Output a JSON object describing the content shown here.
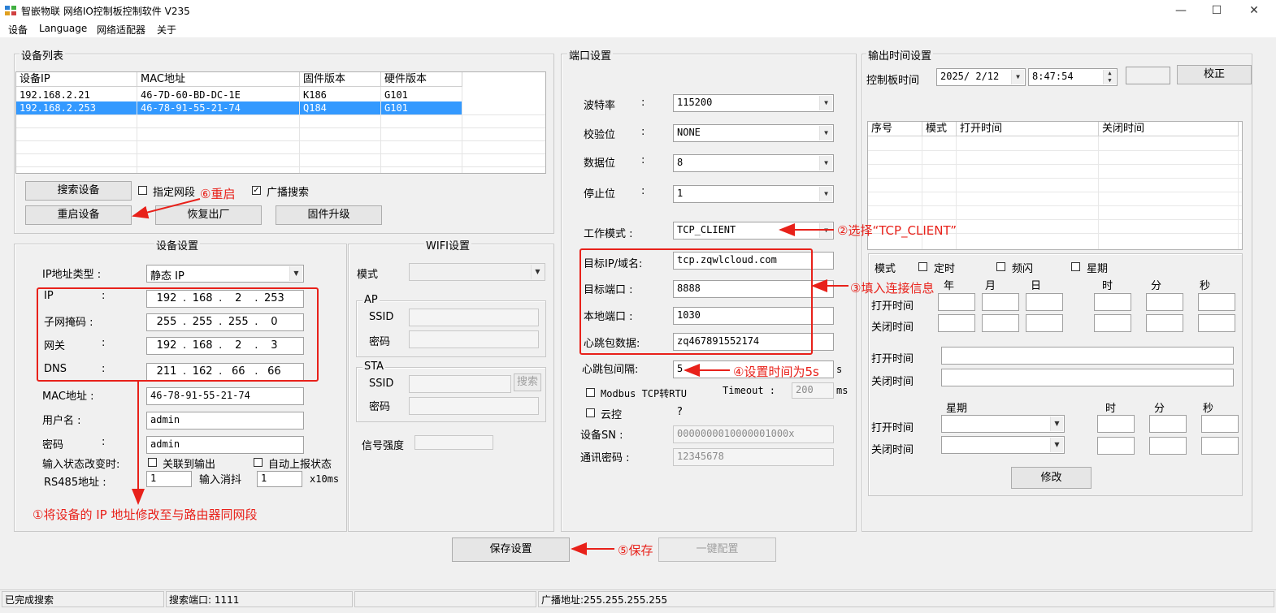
{
  "window": {
    "title": "智嵌物联 网络IO控制板控制软件   V235",
    "min": "—",
    "max": "☐",
    "close": "✕"
  },
  "menu": [
    "设备",
    "Language",
    "网络适配器",
    "关于"
  ],
  "device_list": {
    "legend": "设备列表",
    "columns": [
      "设备IP",
      "MAC地址",
      "固件版本",
      "硬件版本"
    ],
    "rows": [
      {
        "ip": "192.168.2.21",
        "mac": "46-7D-60-BD-DC-1E",
        "fw": "K186",
        "hw": "G101"
      },
      {
        "ip": "192.168.2.253",
        "mac": "46-78-91-55-21-74",
        "fw": "Q184",
        "hw": "G101"
      }
    ],
    "search_btn": "搜索设备",
    "specify_segment": "指定网段",
    "broadcast_search": "广播搜索",
    "restart_btn": "重启设备",
    "factory_btn": "恢复出厂",
    "upgrade_btn": "固件升级"
  },
  "device_settings": {
    "legend": "设备设置",
    "ip_type_label": "IP地址类型 :",
    "ip_type_value": "静态 IP",
    "ip_label": "IP",
    "ip": [
      "192",
      "168",
      "2",
      "253"
    ],
    "mask_label": "子网掩码 :",
    "mask": [
      "255",
      "255",
      "255",
      "0"
    ],
    "gateway_label": "网关",
    "gateway": [
      "192",
      "168",
      "2",
      "3"
    ],
    "dns_label": "DNS",
    "dns": [
      "211",
      "162",
      "66",
      "66"
    ],
    "colon": ":",
    "dot": ".",
    "mac_label": "MAC地址 :",
    "mac": "46-78-91-55-21-74",
    "user_label": "用户名 :",
    "user": "admin",
    "pwd_label": "密码",
    "pwd": "admin",
    "input_change_label": "输入状态改变时:",
    "link_output": "关联到输出",
    "auto_report": "自动上报状态",
    "rs485_label": "RS485地址 :",
    "rs485": "1",
    "debounce_label": "输入消抖",
    "debounce": "1",
    "debounce_unit": "x10ms"
  },
  "wifi": {
    "legend": "WIFI设置",
    "mode_label": "模式",
    "ap": "AP",
    "sta": "STA",
    "ssid_label": "SSID",
    "pwd_label": "密码",
    "search_btn": "搜索",
    "signal_label": "信号强度"
  },
  "port": {
    "legend": "端口设置",
    "baud_label": "波特率",
    "baud": "115200",
    "parity_label": "校验位",
    "parity": "NONE",
    "databits_label": "数据位",
    "databits": "8",
    "stopbits_label": "停止位",
    "stopbits": "1",
    "mode_label": "工作模式 :",
    "mode": "TCP_CLIENT",
    "target_label": "目标IP/域名:",
    "target": "tcp.zqwlcloud.com",
    "tport_label": "目标端口 :",
    "tport": "8888",
    "lport_label": "本地端口 :",
    "lport": "1030",
    "hb_label": "心跳包数据:",
    "hb": "zq467891552174",
    "hbi_label": "心跳包间隔:",
    "hbi": "5",
    "hbi_unit": "s",
    "modbus": "Modbus TCP转RTU",
    "timeout_label": "Timeout :",
    "timeout": "200",
    "timeout_unit": "ms",
    "cloud": "云控",
    "q": "?",
    "sn_label": "设备SN :",
    "sn": "0000000010000001000x",
    "comm_pwd_label": "通讯密码 :",
    "comm_pwd": "12345678"
  },
  "output_time": {
    "legend": "输出时间设置",
    "board_time_label": "控制板时间",
    "date": "2025/ 2/12",
    "time": "8:47:54",
    "calibrate_btn": "校正",
    "columns": [
      "序号",
      "模式",
      "打开时间",
      "关闭时间"
    ],
    "mode_label": "模式",
    "timer": "定时",
    "flash": "频闪",
    "week": "星期",
    "year": "年",
    "month": "月",
    "day": "日",
    "hour": "时",
    "minute": "分",
    "second": "秒",
    "open_time": "打开时间",
    "close_time": "关闭时间",
    "modify_btn": "修改"
  },
  "bottom": {
    "save_btn": "保存设置",
    "oneclick_btn": "一键配置"
  },
  "annotations": {
    "a1": "①将设备的 IP 地址修改至与路由器同网段",
    "a2": "②选择“TCP_CLIENT”",
    "a3": "③填入连接信息",
    "a4": "④设置时间为5s",
    "a5": "⑤保存",
    "a6": "⑥重启"
  },
  "statusbar": {
    "status": "已完成搜索",
    "search_port": "搜索端口: 1111",
    "broadcast": "广播地址:255.255.255.255"
  },
  "colors": {
    "annotation": "#e8211a",
    "selection": "#3399ff"
  }
}
